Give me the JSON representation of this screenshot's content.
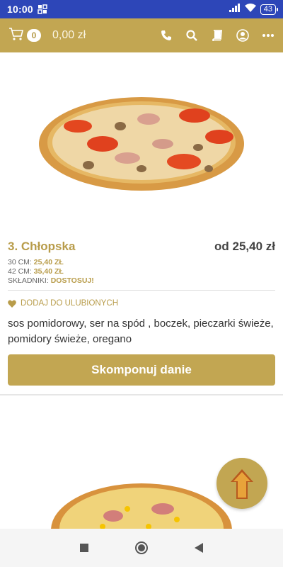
{
  "status_bar": {
    "time": "10:00",
    "battery": "43",
    "icons": [
      "nfc-icon",
      "signal-icon",
      "wifi-icon",
      "battery-icon"
    ]
  },
  "app_bar": {
    "cart_count": "0",
    "cart_total": "0,00 zł",
    "icons": [
      "cart-icon",
      "phone-icon",
      "search-icon",
      "book-icon",
      "account-icon",
      "more-icon"
    ],
    "background_color": "#c2a652"
  },
  "product": {
    "name": "3. Chłopska",
    "price": "od 25,40 zł",
    "size_30_label": "30 CM:",
    "size_30_price": "25,40 ZŁ",
    "size_42_label": "42 CM:",
    "size_42_price": "35,40 ZŁ",
    "ingredients_label": "SKŁADNIKI:",
    "ingredients_action": "DOSTOSUJ!",
    "favorite_label": "DODAJ DO ULUBIONYCH",
    "description": "sos pomidorowy, ser na spód , boczek, pieczarki świeże, pomidory świeże, oregano",
    "compose_button": "Skomponuj danie",
    "accent_color": "#b89c4a"
  },
  "nav_bar": {
    "icons": [
      "recent-apps-icon",
      "home-icon",
      "back-icon"
    ]
  }
}
